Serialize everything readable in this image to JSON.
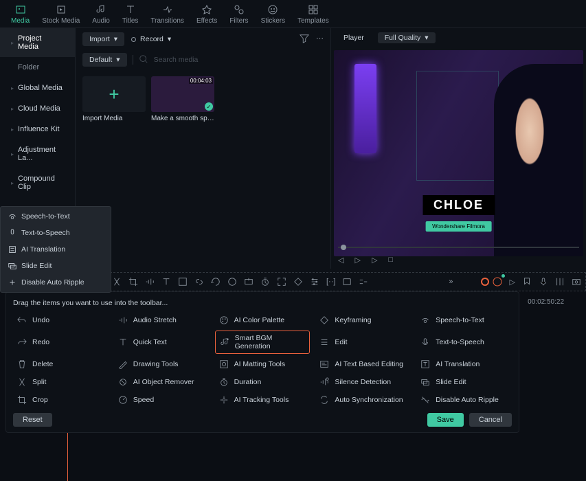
{
  "topTabs": [
    {
      "label": "Media",
      "active": true
    },
    {
      "label": "Stock Media"
    },
    {
      "label": "Audio"
    },
    {
      "label": "Titles"
    },
    {
      "label": "Transitions"
    },
    {
      "label": "Effects"
    },
    {
      "label": "Filters"
    },
    {
      "label": "Stickers"
    },
    {
      "label": "Templates"
    }
  ],
  "sidebar": [
    {
      "label": "Project Media",
      "active": true,
      "chevron": true
    },
    {
      "label": "Folder",
      "sub": true
    },
    {
      "label": "Global Media",
      "chevron": true
    },
    {
      "label": "Cloud Media",
      "chevron": true
    },
    {
      "label": "Influence Kit",
      "chevron": true
    },
    {
      "label": "Adjustment La...",
      "chevron": true
    },
    {
      "label": "Compound Clip",
      "chevron": true
    }
  ],
  "mediaToolbar": {
    "import": "Import",
    "record": "Record",
    "sort": "Default",
    "searchPlaceholder": "Search media"
  },
  "mediaThumbs": {
    "importLabel": "Import Media",
    "clipLabel": "Make a smooth speed...",
    "clipDuration": "00:04:03"
  },
  "player": {
    "tabLabel": "Player",
    "quality": "Full Quality",
    "nameBadge": "CHLOE",
    "brand": "Wondershare Filmora"
  },
  "contextMenu": [
    "Speech-to-Text",
    "Text-to-Speech",
    "AI Translation",
    "Slide Edit",
    "Disable Auto Ripple"
  ],
  "customPanel": {
    "instruction": "Drag the items you want to use into the toolbar...",
    "cols": [
      [
        "Undo",
        "Redo",
        "Delete",
        "Split",
        "Crop"
      ],
      [
        "Audio Stretch",
        "Quick Text",
        "Drawing Tools",
        "AI Object Remover",
        "Speed"
      ],
      [
        "AI Color Palette",
        "Smart BGM Generation",
        "AI Matting Tools",
        "Duration",
        "AI Tracking Tools"
      ],
      [
        "Keyframing",
        "Edit",
        "AI Text Based Editing",
        "Silence Detection",
        "Auto Synchronization"
      ],
      [
        "Speech-to-Text",
        "Text-to-Speech",
        "AI Translation",
        "Slide Edit",
        "Disable Auto Ripple"
      ]
    ],
    "highlightedTool": "Smart BGM Generation",
    "reset": "Reset",
    "save": "Save",
    "cancel": "Cancel"
  },
  "timeline": {
    "timecode": "00:02:50:22"
  }
}
